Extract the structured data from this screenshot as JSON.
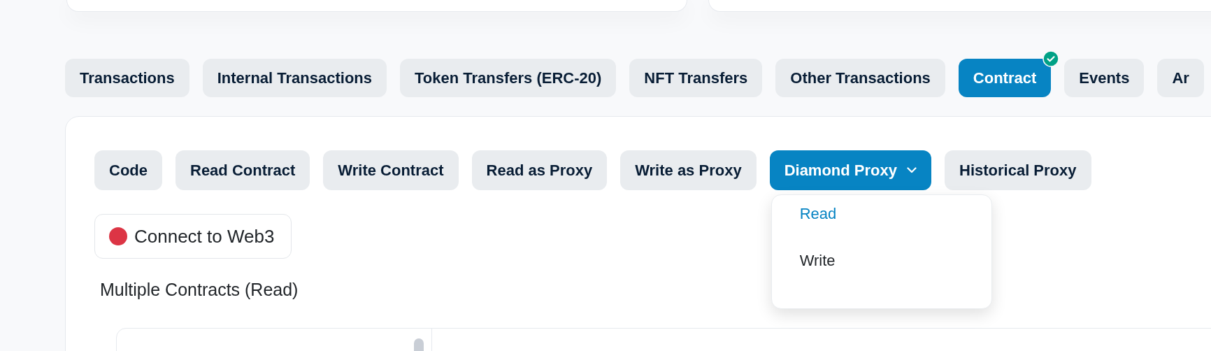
{
  "tabs": [
    {
      "label": "Transactions",
      "selected": false,
      "verified": false
    },
    {
      "label": "Internal Transactions",
      "selected": false,
      "verified": false
    },
    {
      "label": "Token Transfers (ERC-20)",
      "selected": false,
      "verified": false
    },
    {
      "label": "NFT Transfers",
      "selected": false,
      "verified": false
    },
    {
      "label": "Other Transactions",
      "selected": false,
      "verified": false
    },
    {
      "label": "Contract",
      "selected": true,
      "verified": true
    },
    {
      "label": "Events",
      "selected": false,
      "verified": false
    },
    {
      "label": "Ar",
      "selected": false,
      "verified": false
    }
  ],
  "subtabs": [
    {
      "label": "Code",
      "selected": false,
      "kind": "tab"
    },
    {
      "label": "Read Contract",
      "selected": false,
      "kind": "tab"
    },
    {
      "label": "Write Contract",
      "selected": false,
      "kind": "tab"
    },
    {
      "label": "Read as Proxy",
      "selected": false,
      "kind": "tab"
    },
    {
      "label": "Write as Proxy",
      "selected": false,
      "kind": "tab"
    },
    {
      "label": "Diamond Proxy",
      "selected": true,
      "kind": "dropdown",
      "expanded": true,
      "menu": [
        {
          "label": "Read",
          "selected": true
        },
        {
          "label": "Write",
          "selected": false
        }
      ]
    },
    {
      "label": "Historical Proxy",
      "selected": false,
      "kind": "tab"
    }
  ],
  "connect_button": {
    "label": "Connect to Web3",
    "connected": false
  },
  "section_title": "Multiple Contracts (Read)"
}
